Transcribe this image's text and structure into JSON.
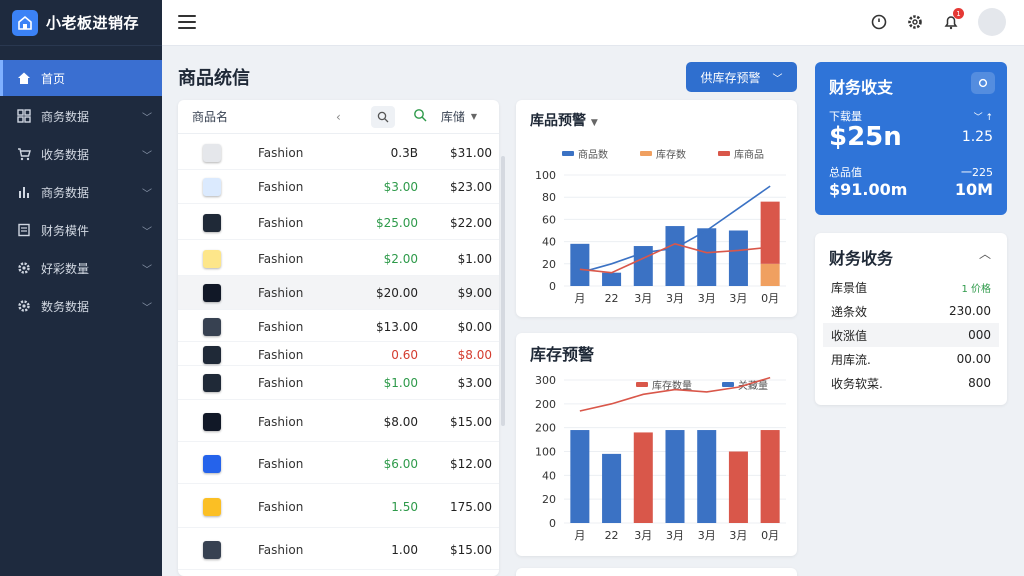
{
  "app": {
    "title": "小老板进销存"
  },
  "sidebar": {
    "items": [
      {
        "label": "首页",
        "icon": "home-icon",
        "active": true
      },
      {
        "label": "商务数据",
        "icon": "grid-icon"
      },
      {
        "label": "收务数据",
        "icon": "cart-icon"
      },
      {
        "label": "商务数据",
        "icon": "bar-chart-icon"
      },
      {
        "label": "财务模件",
        "icon": "document-icon"
      },
      {
        "label": "好彩数量",
        "icon": "gear-icon"
      },
      {
        "label": "数务数据",
        "icon": "settings-icon"
      }
    ]
  },
  "topbar": {
    "notification_count": "1"
  },
  "page": {
    "title": "商品统信"
  },
  "products": {
    "headers": {
      "name": "商品名",
      "stock": "库储"
    },
    "rows": [
      {
        "name": "Fashion",
        "price": "0.3B",
        "stock": "$31.00",
        "price_color": "default",
        "stock_color": "default"
      },
      {
        "name": "Fashion",
        "price": "$3.00",
        "stock": "$23.00",
        "price_color": "green",
        "stock_color": "default"
      },
      {
        "name": "Fashion",
        "price": "$25.00",
        "stock": "$22.00",
        "price_color": "green",
        "stock_color": "default"
      },
      {
        "name": "Fashion",
        "price": "$2.00",
        "stock": "$1.00",
        "price_color": "green",
        "stock_color": "default"
      },
      {
        "name": "Fashion",
        "price": "$20.00",
        "stock": "$9.00",
        "price_color": "default",
        "stock_color": "default"
      },
      {
        "name": "Fashion",
        "price": "$13.00",
        "stock": "$0.00",
        "price_color": "default",
        "stock_color": "default"
      },
      {
        "name": "Fashion",
        "price": "0.60",
        "stock": "$8.00",
        "price_color": "red",
        "stock_color": "red"
      },
      {
        "name": "Fashion",
        "price": "$1.00",
        "stock": "$3.00",
        "price_color": "green",
        "stock_color": "default"
      },
      {
        "name": "Fashion",
        "price": "$8.00",
        "stock": "$15.00",
        "price_color": "default",
        "stock_color": "default"
      },
      {
        "name": "Fashion",
        "price": "$6.00",
        "stock": "$12.00",
        "price_color": "green",
        "stock_color": "default"
      },
      {
        "name": "Fashion",
        "price": "1.50",
        "stock": "175.00",
        "price_color": "green",
        "stock_color": "default"
      },
      {
        "name": "Fashion",
        "price": "1.00",
        "stock": "$15.00",
        "price_color": "default",
        "stock_color": "default"
      }
    ]
  },
  "filter": {
    "label": "供库存预警"
  },
  "chart_data": [
    {
      "type": "bar",
      "title": "库品预警",
      "categories": [
        "月",
        "22",
        "3月",
        "3月",
        "3月",
        "3月",
        "0月"
      ],
      "yticks": [
        "100",
        "80",
        "60",
        "40",
        "20",
        "0"
      ],
      "ylim": [
        0,
        100
      ],
      "series": [
        {
          "name": "商品数",
          "color": "#3b72c4",
          "values": [
            38,
            12,
            36,
            54,
            52,
            50,
            0
          ]
        },
        {
          "name": "库存数",
          "color": "#f0a060",
          "values": [
            0,
            0,
            0,
            0,
            0,
            0,
            20
          ]
        },
        {
          "name": "库商品",
          "color": "#d9574a",
          "values": [
            0,
            0,
            0,
            0,
            0,
            0,
            56
          ]
        }
      ],
      "lines": [
        {
          "color": "#3b72c4",
          "values": [
            12,
            20,
            30,
            34,
            50,
            70,
            90
          ]
        },
        {
          "color": "#d9574a",
          "values": [
            15,
            12,
            25,
            38,
            30,
            32,
            35
          ]
        }
      ]
    },
    {
      "type": "bar",
      "title": "库存预警",
      "categories": [
        "月",
        "22",
        "3月",
        "3月",
        "3月",
        "3月",
        "0月"
      ],
      "yticks": [
        "300",
        "200",
        "200",
        "100",
        "40",
        "20",
        "0"
      ],
      "ylim": [
        0,
        300
      ],
      "series": [
        {
          "name": "库存数量",
          "color": "#d9574a",
          "values": [
            0,
            0,
            190,
            0,
            0,
            150,
            195
          ]
        },
        {
          "name": "关藏量",
          "color": "#3b72c4",
          "values": [
            195,
            145,
            0,
            195,
            195,
            0,
            0
          ]
        }
      ],
      "lines": [
        {
          "color": "#d9574a",
          "values": [
            235,
            250,
            270,
            280,
            275,
            285,
            305
          ]
        }
      ]
    }
  ],
  "finance": {
    "title": "财务收支",
    "row1_label": "下载量",
    "row1_value": "$25n",
    "row1_side": "1.25",
    "row2_label": "总品值",
    "row2_side_label": "一225",
    "row2_value": "$91.00m",
    "row2_side": "10M"
  },
  "ledger": {
    "title": "财务收务",
    "rows": [
      {
        "label": "库景值",
        "value": "1 价格",
        "value_color": "green"
      },
      {
        "label": "递条效",
        "value": "230.00",
        "value_color": "default"
      },
      {
        "label": "收涨值",
        "value": "000",
        "value_color": "default"
      },
      {
        "label": "用库流.",
        "value": "00.00",
        "value_color": "default"
      },
      {
        "label": "收务软菜.",
        "value": "800",
        "value_color": "default"
      }
    ]
  }
}
